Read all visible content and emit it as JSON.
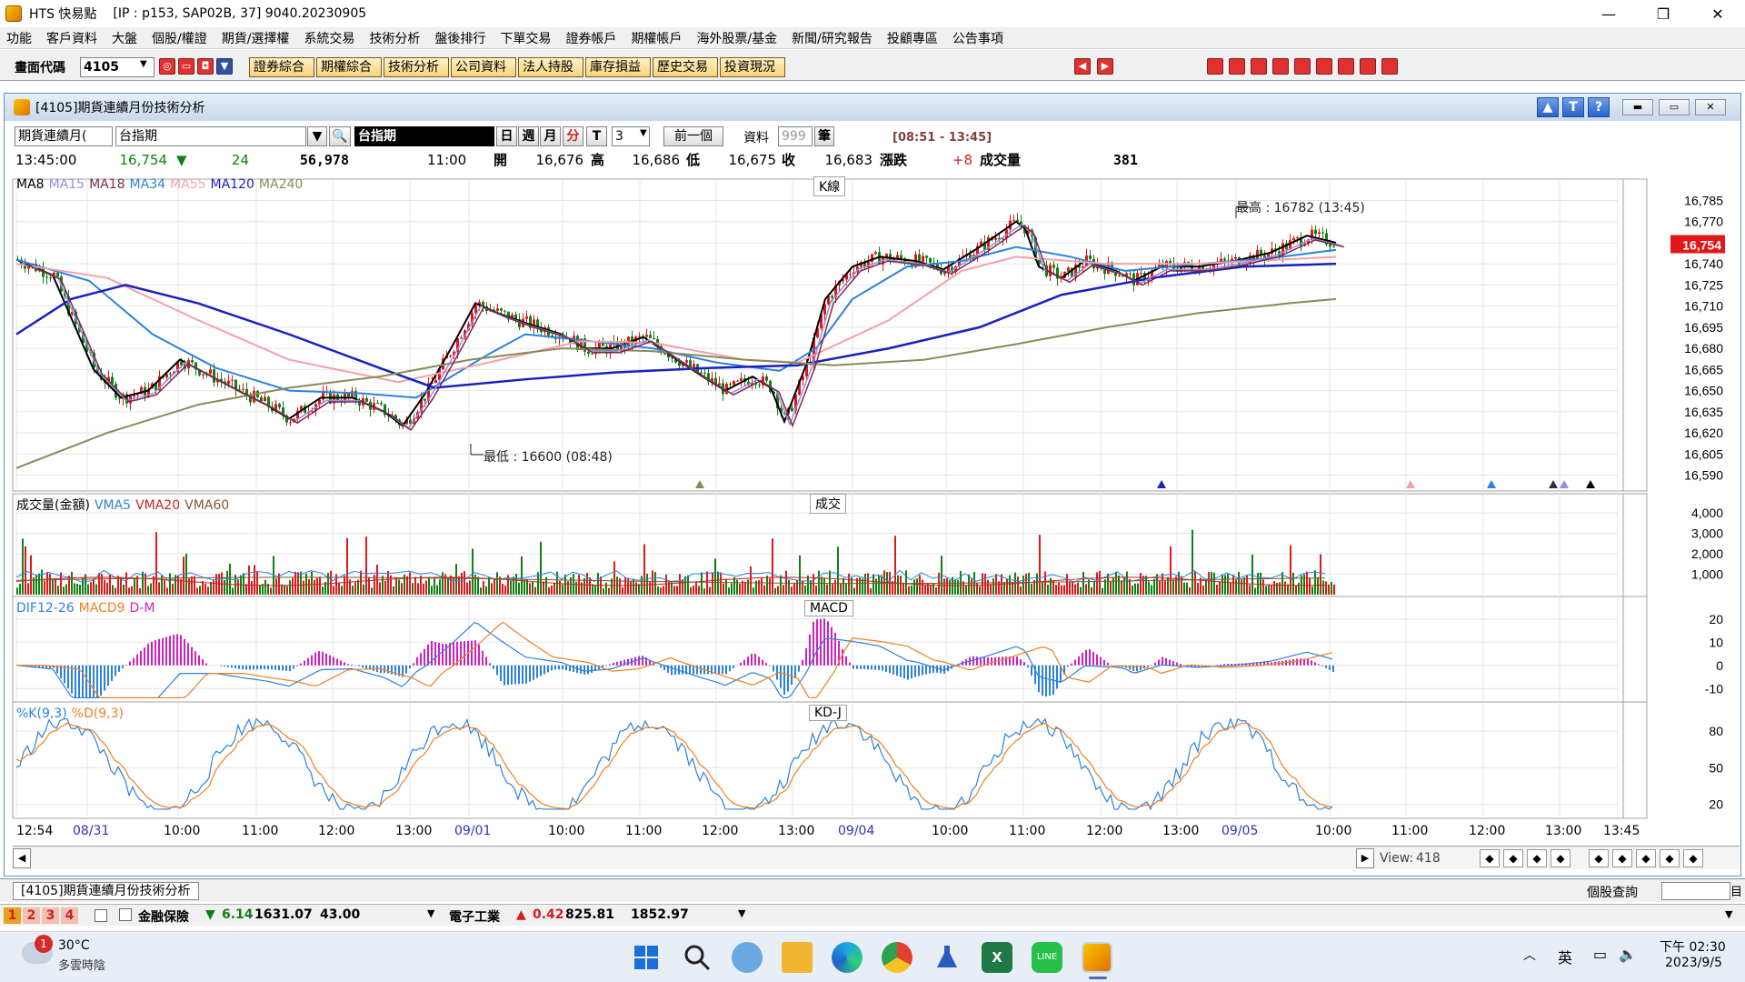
{
  "app": {
    "title": "HTS 快易點",
    "connection": "[IP : p153, SAP02B, 37] 9040.20230905"
  },
  "menu": [
    "功能",
    "客戶資料",
    "大盤",
    "個股/權證",
    "期貨/選擇權",
    "系統交易",
    "技術分析",
    "盤後排行",
    "下單交易",
    "證券帳戶",
    "期權帳戶",
    "海外股票/基金",
    "新聞/研究報告",
    "投顧專區",
    "公告事項"
  ],
  "toolbar": {
    "code_label": "畫面代碼",
    "code_value": "4105",
    "buttons": [
      "證券綜合",
      "期權綜合",
      "技術分析",
      "公司資料",
      "法人持股",
      "庫存損益",
      "歷史交易",
      "投資現況"
    ]
  },
  "child": {
    "title": "[4105]期貨連續月份技術分析",
    "tab_label": "[4105]期貨連續月份技術分析"
  },
  "controls": {
    "contract_type": "期貨連續月(",
    "product": "台指期",
    "display_name": "台指期",
    "periods": [
      "日",
      "週",
      "月",
      "分",
      "T"
    ],
    "period_selected": "分",
    "interval": "3",
    "prev_button": "前一個",
    "data_label": "資料",
    "data_count": "999",
    "data_unit": "筆",
    "time_range": "[08:51 - 13:45]"
  },
  "quote": {
    "time": "13:45:00",
    "price": "16,754",
    "change": "24",
    "volume_total": "56,978",
    "time2": "11:00",
    "open_label": "開",
    "open": "16,676",
    "high_label": "高",
    "high": "16,686",
    "low_label": "低",
    "low": "16,675",
    "close_label": "收",
    "close": "16,683",
    "chg_label": "漲跌",
    "chg": "+8",
    "vol_label": "成交量",
    "vol": "381"
  },
  "ma_legend": [
    {
      "name": "MA8",
      "color": "#000000"
    },
    {
      "name": "MA15",
      "color": "#9a8ae0"
    },
    {
      "name": "MA18",
      "color": "#7a2a4a"
    },
    {
      "name": "MA34",
      "color": "#2a82e0"
    },
    {
      "name": "MA55",
      "color": "#f4a0a8"
    },
    {
      "name": "MA120",
      "color": "#1820c0"
    },
    {
      "name": "MA240",
      "color": "#8a8a58"
    }
  ],
  "panels": {
    "kline_tag": "K線",
    "volume_tag": "成交",
    "macd_tag": "MACD",
    "kd_tag": "KD-J"
  },
  "volume_legend": [
    {
      "name": "成交量(金額)",
      "color": "#000000"
    },
    {
      "name": "VMA5",
      "color": "#2a82e0"
    },
    {
      "name": "VMA20",
      "color": "#d02020"
    },
    {
      "name": "VMA60",
      "color": "#7a5a30"
    }
  ],
  "macd_legend": [
    {
      "name": "DIF12-26",
      "color": "#2a82e0"
    },
    {
      "name": "MACD9",
      "color": "#f08020"
    },
    {
      "name": "D-M",
      "color": "#d020c0"
    }
  ],
  "kd_legend": [
    {
      "name": "%K(9,3)",
      "color": "#2a82e0"
    },
    {
      "name": "%D(9,3)",
      "color": "#f08020"
    }
  ],
  "annotations": {
    "high": "最高 : 16782 (13:45)",
    "low": "最低 : 16600 (08:48)"
  },
  "chart_data": [
    {
      "type": "candlestick",
      "title": "K線",
      "yticks": [
        16785,
        16770,
        16755,
        16740,
        16725,
        16710,
        16695,
        16680,
        16665,
        16650,
        16635,
        16620,
        16605,
        16590
      ],
      "ylim": [
        16580,
        16795
      ],
      "ytick_labels": [
        "16,785",
        "16,770",
        "16,754",
        "16,740",
        "16,725",
        "16,710",
        "16,695",
        "16,680",
        "16,665",
        "16,650",
        "16,635",
        "16,620",
        "16,605",
        "16,590"
      ],
      "last_price": "16,754",
      "series": [
        {
          "name": "MA8",
          "points": [
            [
              0,
              16743
            ],
            [
              40,
              16732
            ],
            [
              85,
              16665
            ],
            [
              115,
              16645
            ],
            [
              145,
              16650
            ],
            [
              180,
              16672
            ],
            [
              215,
              16660
            ],
            [
              250,
              16648
            ],
            [
              275,
              16640
            ],
            [
              300,
              16630
            ],
            [
              335,
              16645
            ],
            [
              370,
              16645
            ],
            [
              405,
              16635
            ],
            [
              425,
              16625
            ],
            [
              450,
              16648
            ],
            [
              480,
              16682
            ],
            [
              505,
              16712
            ],
            [
              530,
              16705
            ],
            [
              560,
              16698
            ],
            [
              600,
              16690
            ],
            [
              625,
              16680
            ],
            [
              655,
              16680
            ],
            [
              690,
              16688
            ],
            [
              720,
              16675
            ],
            [
              755,
              16660
            ],
            [
              780,
              16650
            ],
            [
              810,
              16660
            ],
            [
              830,
              16652
            ],
            [
              845,
              16628
            ],
            [
              870,
              16670
            ],
            [
              890,
              16715
            ],
            [
              920,
              16738
            ],
            [
              950,
              16745
            ],
            [
              990,
              16742
            ],
            [
              1020,
              16736
            ],
            [
              1060,
              16752
            ],
            [
              1100,
              16770
            ],
            [
              1110,
              16765
            ],
            [
              1125,
              16738
            ],
            [
              1150,
              16730
            ],
            [
              1175,
              16742
            ],
            [
              1210,
              16735
            ],
            [
              1230,
              16728
            ],
            [
              1260,
              16738
            ],
            [
              1300,
              16738
            ],
            [
              1340,
              16742
            ],
            [
              1380,
              16748
            ],
            [
              1420,
              16760
            ],
            [
              1452,
              16755
            ]
          ]
        },
        {
          "name": "MA34",
          "points": [
            [
              0,
              16743
            ],
            [
              80,
              16728
            ],
            [
              150,
              16690
            ],
            [
              220,
              16666
            ],
            [
              300,
              16650
            ],
            [
              380,
              16648
            ],
            [
              440,
              16645
            ],
            [
              520,
              16676
            ],
            [
              560,
              16690
            ],
            [
              620,
              16686
            ],
            [
              700,
              16680
            ],
            [
              770,
              16670
            ],
            [
              840,
              16664
            ],
            [
              880,
              16680
            ],
            [
              920,
              16715
            ],
            [
              980,
              16738
            ],
            [
              1040,
              16742
            ],
            [
              1100,
              16752
            ],
            [
              1160,
              16745
            ],
            [
              1220,
              16735
            ],
            [
              1300,
              16740
            ],
            [
              1380,
              16744
            ],
            [
              1452,
              16750
            ]
          ]
        },
        {
          "name": "MA55",
          "points": [
            [
              0,
              16740
            ],
            [
              100,
              16730
            ],
            [
              200,
              16700
            ],
            [
              300,
              16672
            ],
            [
              420,
              16656
            ],
            [
              520,
              16670
            ],
            [
              620,
              16685
            ],
            [
              700,
              16684
            ],
            [
              800,
              16672
            ],
            [
              860,
              16670
            ],
            [
              960,
              16700
            ],
            [
              1040,
              16735
            ],
            [
              1100,
              16745
            ],
            [
              1200,
              16740
            ],
            [
              1300,
              16740
            ],
            [
              1452,
              16745
            ]
          ]
        },
        {
          "name": "MA120",
          "points": [
            [
              0,
              16690
            ],
            [
              60,
              16715
            ],
            [
              120,
              16725
            ],
            [
              200,
              16712
            ],
            [
              300,
              16690
            ],
            [
              400,
              16666
            ],
            [
              460,
              16652
            ],
            [
              560,
              16658
            ],
            [
              660,
              16663
            ],
            [
              760,
              16666
            ],
            [
              860,
              16668
            ],
            [
              960,
              16680
            ],
            [
              1060,
              16695
            ],
            [
              1150,
              16718
            ],
            [
              1250,
              16730
            ],
            [
              1350,
              16738
            ],
            [
              1452,
              16740
            ]
          ]
        },
        {
          "name": "MA240",
          "points": [
            [
              0,
              16595
            ],
            [
              100,
              16620
            ],
            [
              200,
              16640
            ],
            [
              300,
              16652
            ],
            [
              400,
              16660
            ],
            [
              500,
              16672
            ],
            [
              600,
              16680
            ],
            [
              700,
              16678
            ],
            [
              800,
              16672
            ],
            [
              900,
              16668
            ],
            [
              1000,
              16672
            ],
            [
              1100,
              16683
            ],
            [
              1200,
              16695
            ],
            [
              1300,
              16705
            ],
            [
              1400,
              16712
            ],
            [
              1452,
              16715
            ]
          ]
        }
      ]
    },
    {
      "type": "bar",
      "title": "成交",
      "yticks": [
        4000,
        3000,
        2000,
        1000
      ],
      "ylim": [
        0,
        4500
      ],
      "ytick_labels": [
        "4,000",
        "3,000",
        "2,000",
        "1,000"
      ]
    },
    {
      "type": "line",
      "title": "MACD",
      "yticks": [
        20,
        10,
        0,
        -10
      ],
      "ylim": [
        -15,
        25
      ],
      "ytick_labels": [
        "20",
        "10",
        "0",
        "-10"
      ]
    },
    {
      "type": "line",
      "title": "KD-J",
      "yticks": [
        80,
        50,
        20
      ],
      "ylim": [
        10,
        95
      ],
      "ytick_labels": [
        "80",
        "50",
        "20"
      ]
    }
  ],
  "x_axis": [
    {
      "t": "12:54",
      "c": "#000"
    },
    {
      "t": "08/31",
      "c": "#3030c0"
    },
    {
      "t": "10:00",
      "c": "#000"
    },
    {
      "t": "11:00",
      "c": "#000"
    },
    {
      "t": "12:00",
      "c": "#000"
    },
    {
      "t": "13:00",
      "c": "#000"
    },
    {
      "t": "09/01",
      "c": "#3030c0"
    },
    {
      "t": "10:00",
      "c": "#000"
    },
    {
      "t": "11:00",
      "c": "#000"
    },
    {
      "t": "12:00",
      "c": "#000"
    },
    {
      "t": "13:00",
      "c": "#000"
    },
    {
      "t": "09/04",
      "c": "#3030c0"
    },
    {
      "t": "10:00",
      "c": "#000"
    },
    {
      "t": "11:00",
      "c": "#000"
    },
    {
      "t": "12:00",
      "c": "#000"
    },
    {
      "t": "13:00",
      "c": "#000"
    },
    {
      "t": "09/05",
      "c": "#3030c0"
    },
    {
      "t": "10:00",
      "c": "#000"
    },
    {
      "t": "11:00",
      "c": "#000"
    },
    {
      "t": "12:00",
      "c": "#000"
    },
    {
      "t": "13:00",
      "c": "#000"
    },
    {
      "t": "13:45",
      "c": "#000"
    }
  ],
  "view": {
    "label": "View:",
    "value": "418"
  },
  "status": {
    "right_label": "個股查詢"
  },
  "tickers": [
    {
      "name": "金融保險",
      "dir": "▼",
      "chg": "6.14",
      "val": "1631.07",
      "extra": "43.00"
    },
    {
      "name": "電子工業",
      "dir": "▲",
      "chg": "0.42",
      "val": "825.81",
      "extra": "1852.97"
    }
  ],
  "tabs": [
    "1",
    "2",
    "3",
    "4"
  ],
  "weather": {
    "temp": "30°C",
    "desc": "多雲時陰",
    "badge": "1"
  },
  "tray": {
    "ime": "英",
    "time": "下午 02:30",
    "date": "2023/9/5"
  }
}
